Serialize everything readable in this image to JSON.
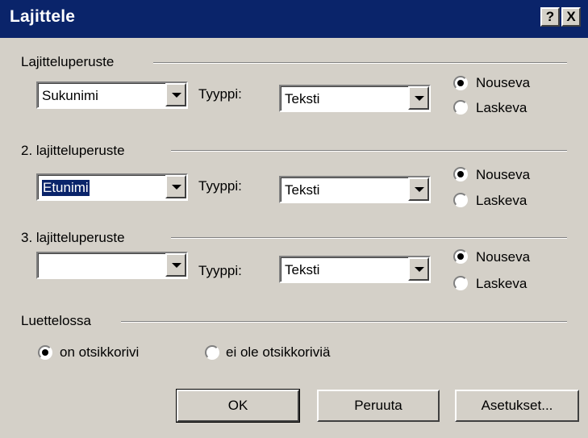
{
  "window": {
    "title": "Lajittele",
    "help_label": "?",
    "close_label": "X"
  },
  "sort1": {
    "group_label": "Lajitteluperuste",
    "field_value": "Sukunimi",
    "type_label": "Tyyppi:",
    "type_value": "Teksti",
    "asc_label": "Nouseva",
    "desc_label": "Laskeva"
  },
  "sort2": {
    "group_label": "2. lajitteluperuste",
    "field_value": "Etunimi",
    "type_label": "Tyyppi:",
    "type_value": "Teksti",
    "asc_label": "Nouseva",
    "desc_label": "Laskeva"
  },
  "sort3": {
    "group_label": "3. lajitteluperuste",
    "field_value": "",
    "type_label": "Tyyppi:",
    "type_value": "Teksti",
    "asc_label": "Nouseva",
    "desc_label": "Laskeva"
  },
  "list": {
    "group_label": "Luettelossa",
    "has_header_label": "on otsikkorivi",
    "no_header_label": "ei ole otsikkoriviä"
  },
  "buttons": {
    "ok": "OK",
    "cancel": "Peruuta",
    "options": "Asetukset..."
  }
}
